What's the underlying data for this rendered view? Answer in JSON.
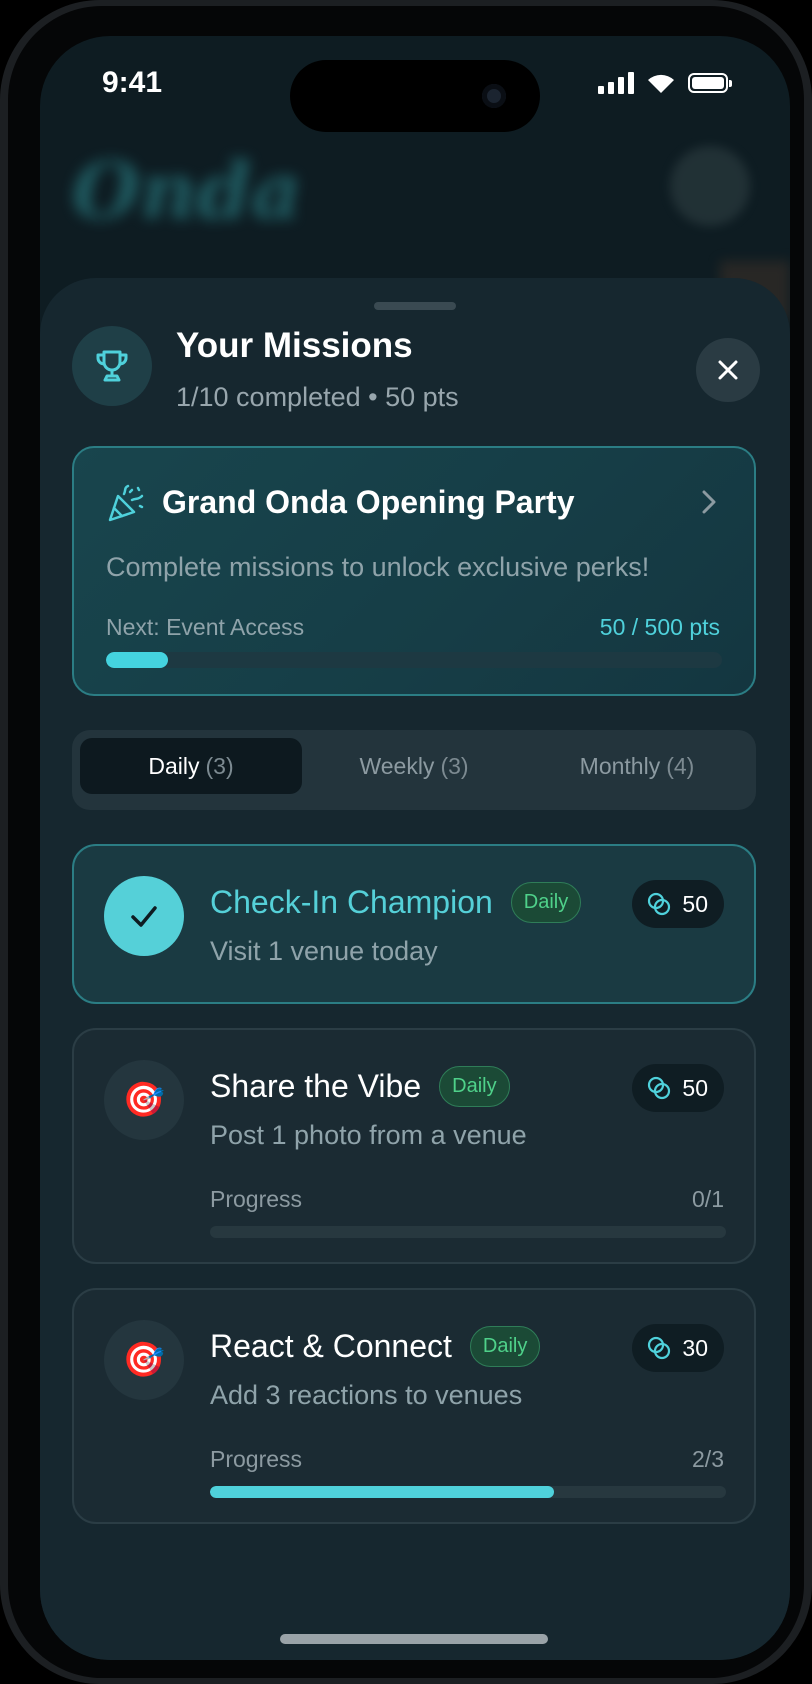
{
  "status_bar": {
    "time": "9:41"
  },
  "background": {
    "app_logo_text": "Onda"
  },
  "sheet": {
    "title": "Your Missions",
    "subtitle": "1/10 completed • 50 pts"
  },
  "event": {
    "title": "Grand Onda Opening Party",
    "description": "Complete missions to unlock exclusive perks!",
    "next_label": "Next: Event Access",
    "points_label": "50 / 500 pts",
    "progress_fraction": 0.1
  },
  "tabs": [
    {
      "label": "Daily",
      "count": "(3)",
      "active": true
    },
    {
      "label": "Weekly",
      "count": "(3)",
      "active": false
    },
    {
      "label": "Monthly",
      "count": "(4)",
      "active": false
    }
  ],
  "missions": [
    {
      "title": "Check-In Champion",
      "badge": "Daily",
      "points": "50",
      "description": "Visit 1 venue today",
      "completed": true
    },
    {
      "title": "Share the Vibe",
      "badge": "Daily",
      "points": "50",
      "description": "Post 1 photo from a venue",
      "progress_label": "Progress",
      "progress_value": "0/1",
      "progress_fraction": 0.0
    },
    {
      "title": "React & Connect",
      "badge": "Daily",
      "points": "30",
      "description": "Add 3 reactions to venues",
      "progress_label": "Progress",
      "progress_value": "2/3",
      "progress_fraction": 0.667
    }
  ],
  "colors": {
    "accent": "#4fd1db",
    "badge_green": "#4fd18a",
    "sheet_bg": "#16272f"
  },
  "icons": {
    "header": "trophy-icon",
    "close": "close-icon",
    "event": "party-popper-icon",
    "mission_done": "checkmark-icon",
    "mission_todo": "target-icon",
    "points": "coins-icon"
  }
}
